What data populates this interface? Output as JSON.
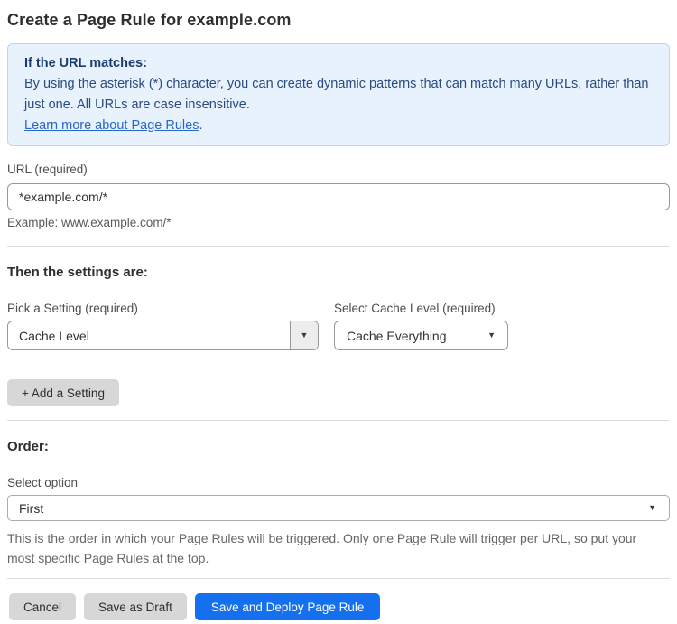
{
  "page": {
    "title": "Create a Page Rule for example.com"
  },
  "colors": {
    "info_box_bg": "#e8f2fc",
    "info_box_border": "#b9d6f2",
    "info_text": "#2a4a82",
    "link_blue": "#2767c8",
    "primary_button_blue": "#1570ef",
    "gray_button_bg": "#d7d7d7"
  },
  "icons": {
    "dropdown_arrow": "▼"
  },
  "info_box": {
    "heading": "If the URL matches:",
    "body": "By using the asterisk (*) character, you can create dynamic patterns that can match many URLs, rather than just one. All URLs are case insensitive.",
    "link_text": "Learn more about Page Rules",
    "link_suffix": "."
  },
  "url_field": {
    "label": "URL (required)",
    "value": "*example.com/*",
    "example": "Example: www.example.com/*"
  },
  "settings": {
    "heading": "Then the settings are:",
    "pick_setting_label": "Pick a Setting (required)",
    "pick_setting_value": "Cache Level",
    "cache_level_label": "Select Cache Level (required)",
    "cache_level_value": "Cache Everything",
    "add_setting_button": "+ Add a Setting"
  },
  "order": {
    "heading": "Order:",
    "label": "Select option",
    "value": "First",
    "help": "This is the order in which your Page Rules will be triggered. Only one Page Rule will trigger per URL, so put your most specific Page Rules at the top."
  },
  "actions": {
    "cancel": "Cancel",
    "save_draft": "Save as Draft",
    "save_deploy": "Save and Deploy Page Rule"
  }
}
